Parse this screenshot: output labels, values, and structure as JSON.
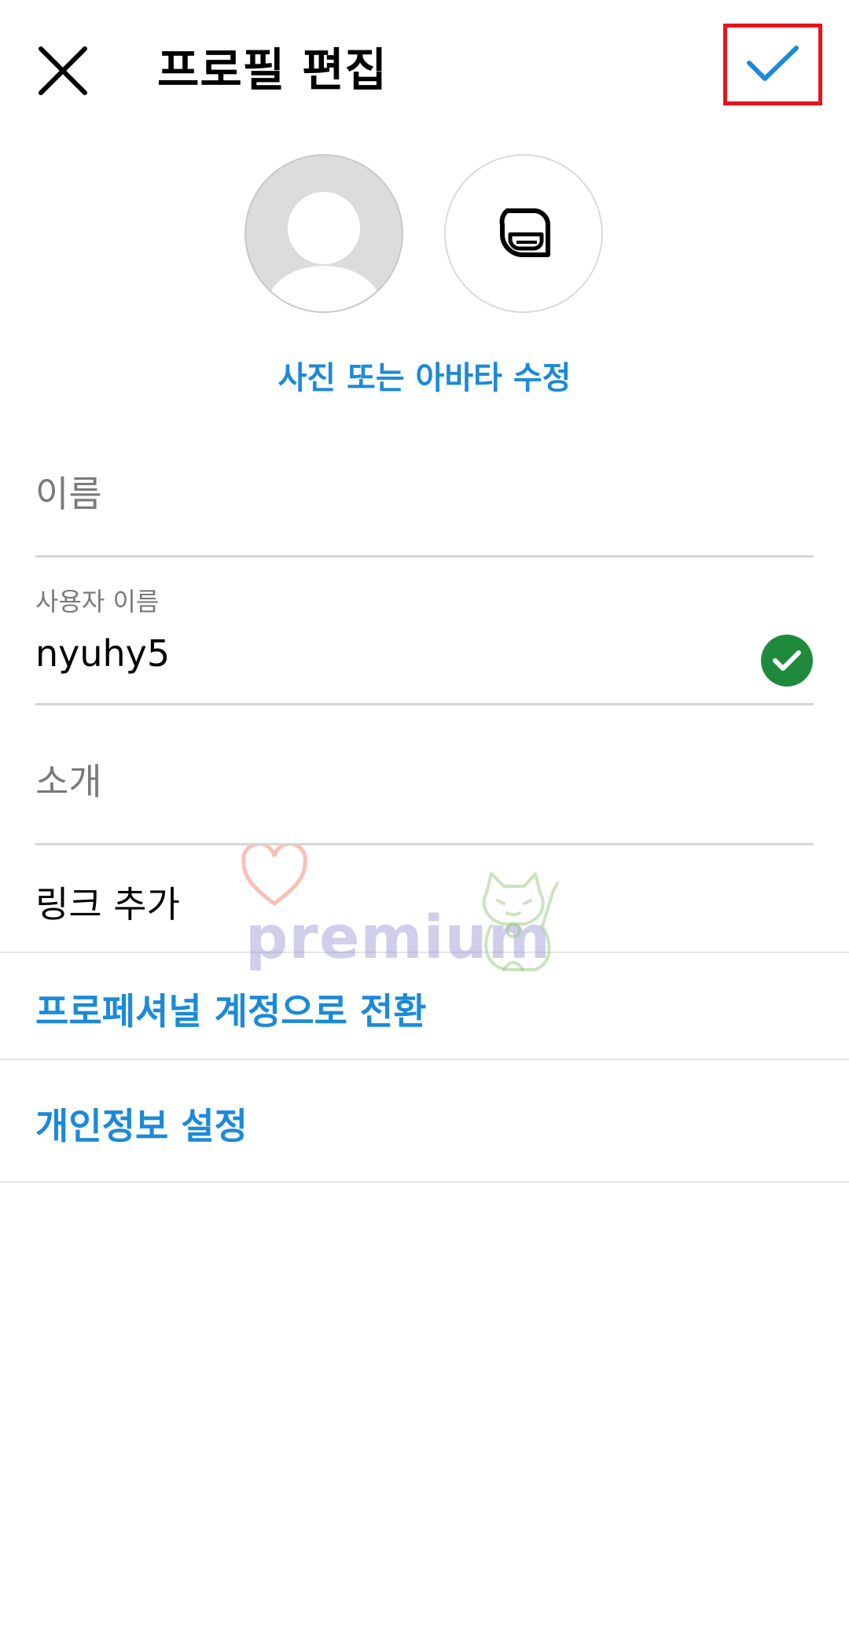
{
  "header": {
    "title": "프로필 편집",
    "close_icon": "close-icon",
    "done_icon": "check-icon"
  },
  "avatar": {
    "edit_link": "사진 또는 아바타 수정",
    "photo_icon": "default-avatar-icon",
    "alt_icon": "avatar-face-icon"
  },
  "fields": {
    "name": {
      "placeholder": "이름"
    },
    "username": {
      "label": "사용자 이름",
      "value": "nyuhy5",
      "valid_icon": "check-circle-icon"
    },
    "bio": {
      "placeholder": "소개"
    },
    "links": {
      "label": "링크 추가"
    }
  },
  "links": {
    "professional": "프로페셔널 계정으로 전환",
    "privacy": "개인정보 설정"
  },
  "watermark": {
    "text": "premium"
  },
  "colors": {
    "accent": "#1c8ad8",
    "valid": "#1f8a3b",
    "highlight": "#e8141c"
  }
}
